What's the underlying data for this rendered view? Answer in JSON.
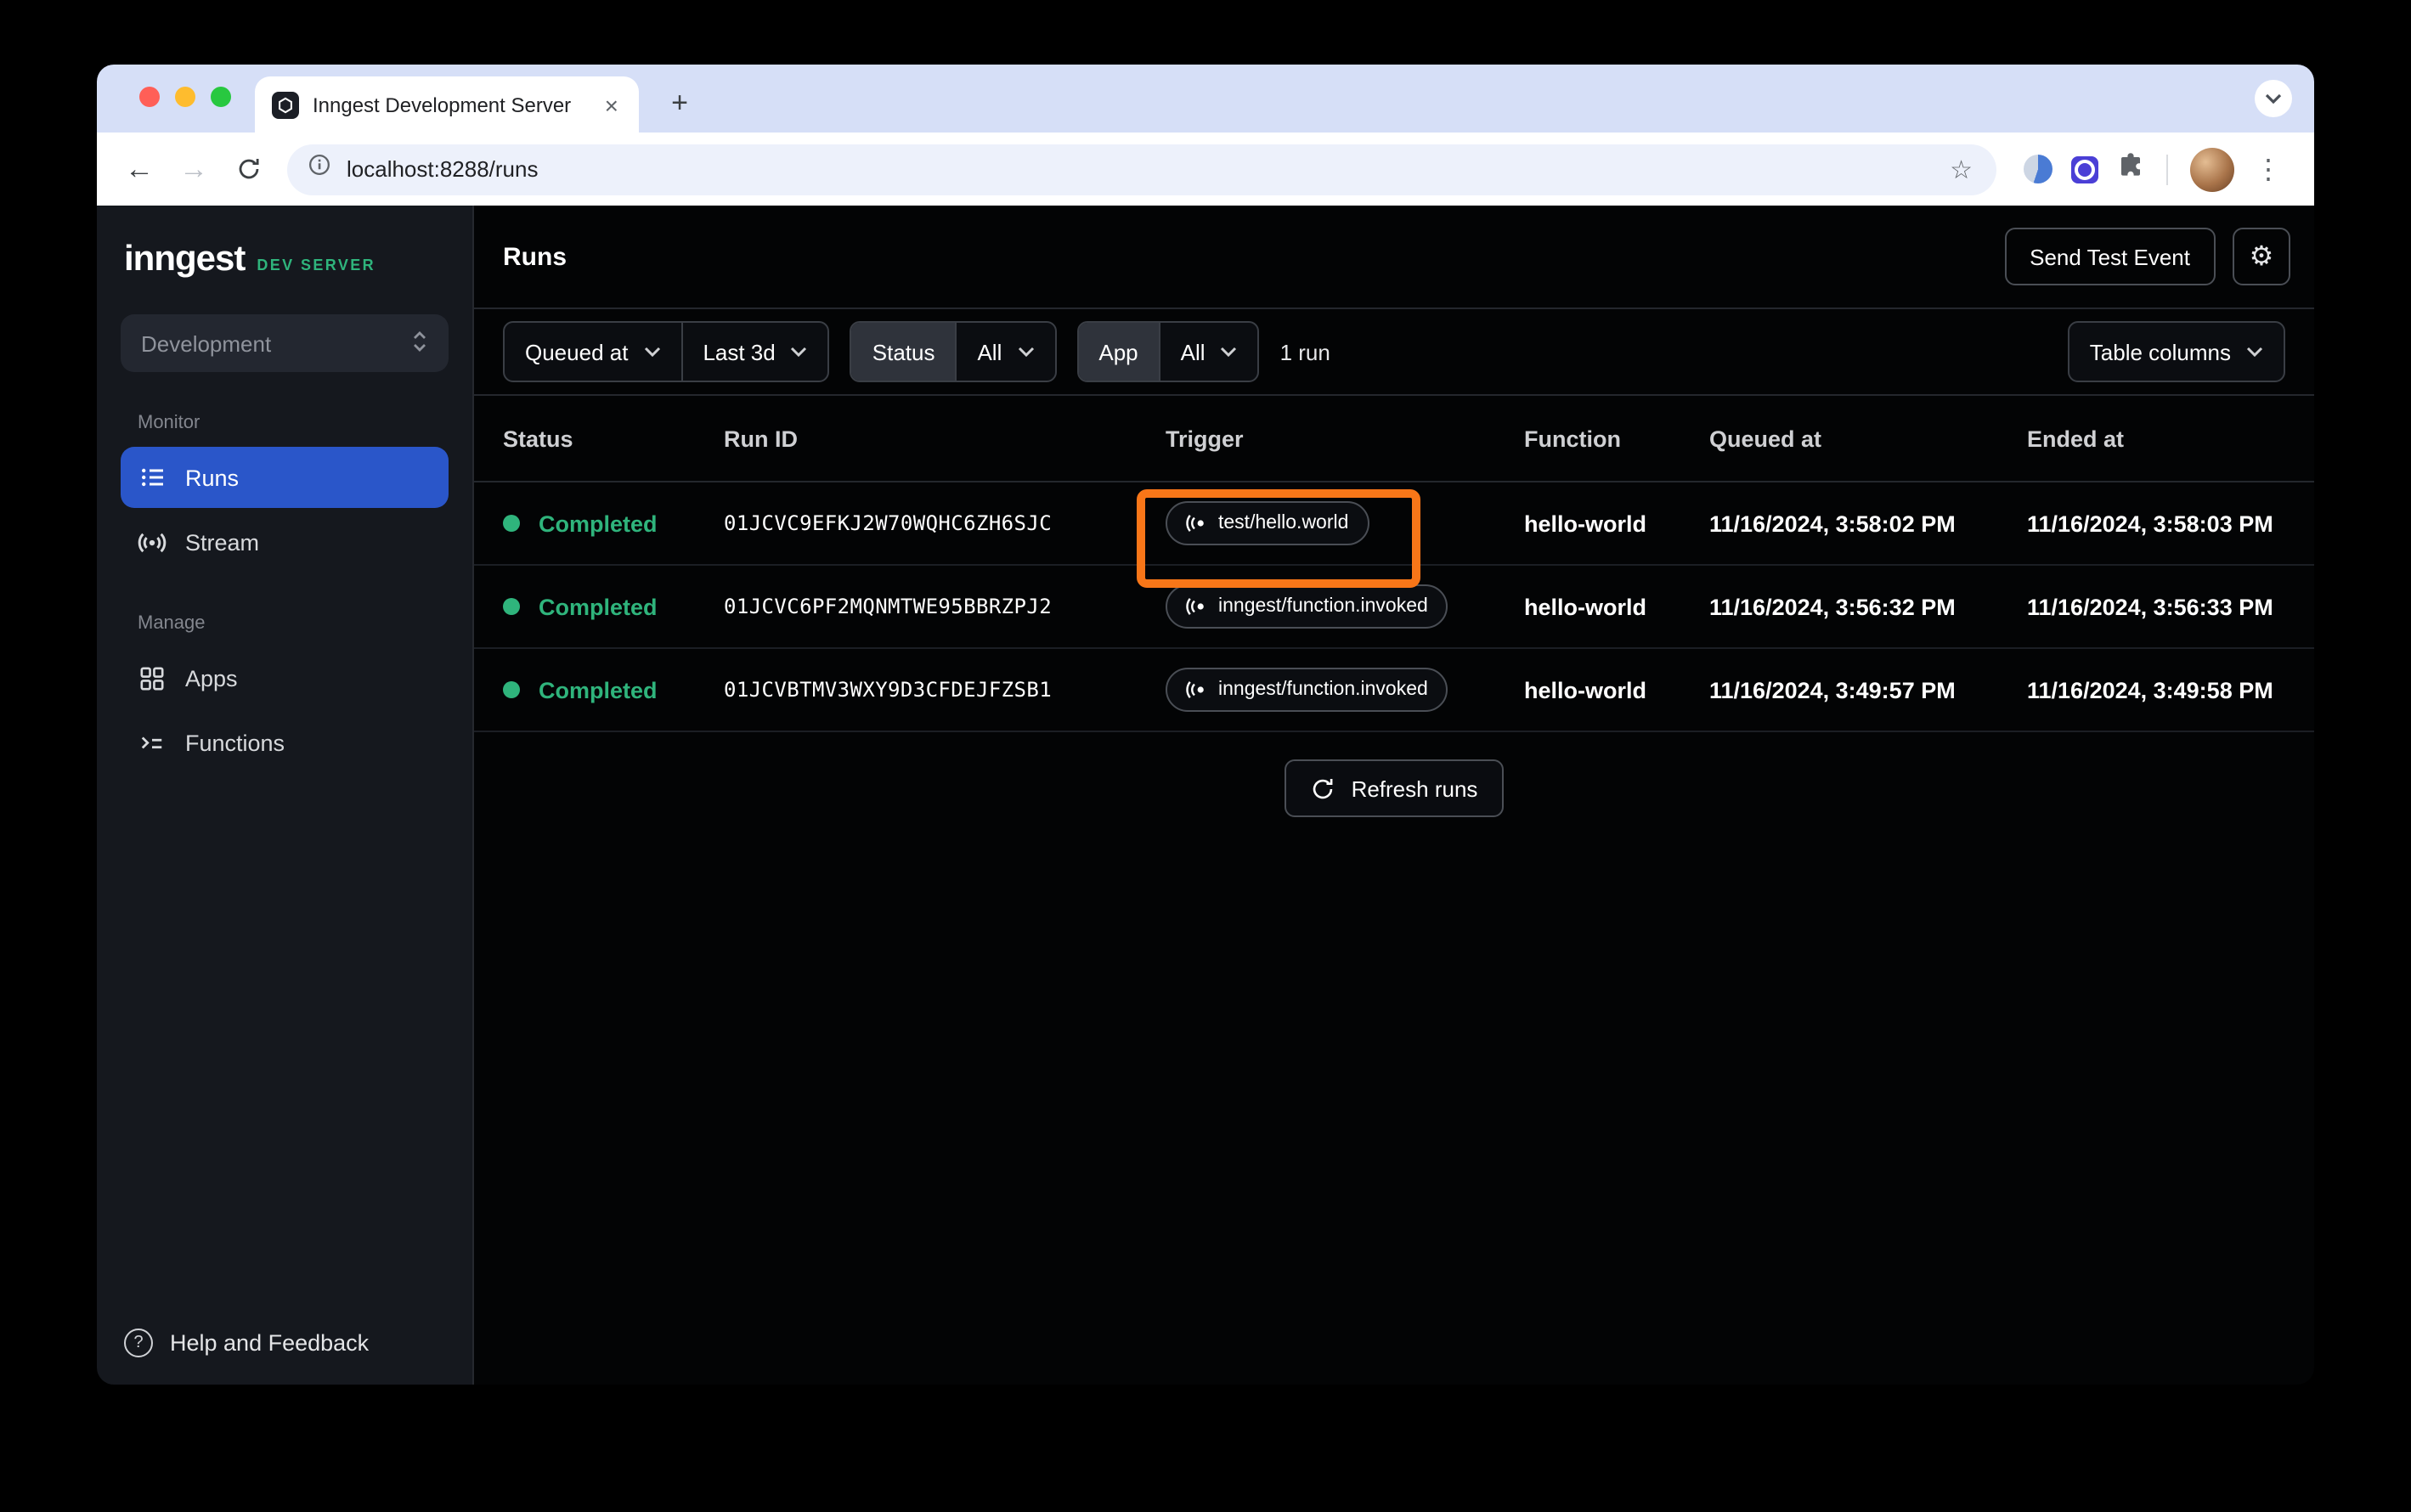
{
  "browser": {
    "tab_title": "Inngest Development Server",
    "url": "localhost:8288/runs"
  },
  "icons": {
    "back": "←",
    "forward": "→",
    "star": "☆",
    "kebab": "⋮",
    "plus": "+",
    "close_tab": "×",
    "gear": "⚙",
    "help": "?"
  },
  "sidebar": {
    "logo_text": "inngest",
    "logo_badge": "DEV SERVER",
    "environment": "Development",
    "monitor_label": "Monitor",
    "runs_label": "Runs",
    "stream_label": "Stream",
    "manage_label": "Manage",
    "apps_label": "Apps",
    "functions_label": "Functions",
    "help_label": "Help and Feedback"
  },
  "header": {
    "title": "Runs",
    "send_test_event_label": "Send Test Event"
  },
  "filters": {
    "queued_at_label": "Queued at",
    "time_range": "Last 3d",
    "status_label": "Status",
    "status_value": "All",
    "app_label": "App",
    "app_value": "All",
    "run_count": "1 run",
    "table_columns_label": "Table columns"
  },
  "table": {
    "columns": [
      "Status",
      "Run ID",
      "Trigger",
      "Function",
      "Queued at",
      "Ended at"
    ],
    "rows": [
      {
        "status": "Completed",
        "run_id": "01JCVC9EFKJ2W70WQHC6ZH6SJC",
        "trigger": "test/hello.world",
        "function": "hello-world",
        "queued_at": "11/16/2024, 3:58:02 PM",
        "ended_at": "11/16/2024, 3:58:03 PM",
        "highlighted": true
      },
      {
        "status": "Completed",
        "run_id": "01JCVC6PF2MQNMTWE95BBRZPJ2",
        "trigger": "inngest/function.invoked",
        "function": "hello-world",
        "queued_at": "11/16/2024, 3:56:32 PM",
        "ended_at": "11/16/2024, 3:56:33 PM",
        "highlighted": false
      },
      {
        "status": "Completed",
        "run_id": "01JCVBTMV3WXY9D3CFDEJFZSB1",
        "trigger": "inngest/function.invoked",
        "function": "hello-world",
        "queued_at": "11/16/2024, 3:49:57 PM",
        "ended_at": "11/16/2024, 3:49:58 PM",
        "highlighted": false
      }
    ],
    "refresh_label": "Refresh runs"
  },
  "colors": {
    "accent_blue": "#2a56c9",
    "brand_green": "#2fb47c",
    "status_green": "#2fb47c",
    "highlight_orange": "#f87618"
  }
}
